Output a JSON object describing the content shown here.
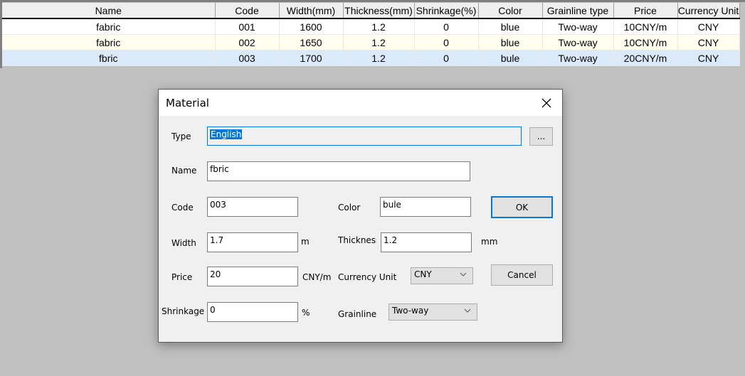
{
  "table": {
    "columns": [
      "Name",
      "Code",
      "Width(mm)",
      "Thickness(mm)",
      "Shrinkage(%)",
      "Color",
      "Grainline type",
      "Price",
      "Currency Unit"
    ],
    "rows": [
      [
        "fabric",
        "001",
        "1600",
        "1.2",
        "0",
        "blue",
        "Two-way",
        "10CNY/m",
        "CNY"
      ],
      [
        "fabric",
        "002",
        "1650",
        "1.2",
        "0",
        "blue",
        "Two-way",
        "10CNY/m",
        "CNY"
      ],
      [
        "fbric",
        "003",
        "1700",
        "1.2",
        "0",
        "bule",
        "Two-way",
        "20CNY/m",
        "CNY"
      ]
    ],
    "selected_row": 2
  },
  "dialog": {
    "title": "Material",
    "close_icon": "close-icon",
    "type": {
      "label": "Type",
      "value": "English",
      "browse_label": "..."
    },
    "name": {
      "label": "Name",
      "value": "fbric"
    },
    "code": {
      "label": "Code",
      "value": "003"
    },
    "color": {
      "label": "Color",
      "value": "bule"
    },
    "width": {
      "label": "Width",
      "value": "1.7",
      "unit": "m"
    },
    "thickness": {
      "label": "Thickness",
      "value": "1.2",
      "unit": "mm"
    },
    "price": {
      "label": "Price",
      "value": "20",
      "unit": "CNY/m"
    },
    "currency": {
      "label": "Currency Unit",
      "value": "CNY"
    },
    "shrinkage": {
      "label": "Shrinkage",
      "value": "0",
      "unit": "%"
    },
    "grainline": {
      "label": "Grainline",
      "value": "Two-way"
    },
    "ok_label": "OK",
    "cancel_label": "Cancel"
  },
  "colors": {
    "accent": "#0078d7",
    "selected_row": "#dbeafa",
    "alt_row": "#fffff0",
    "background": "#c0c0c0"
  }
}
